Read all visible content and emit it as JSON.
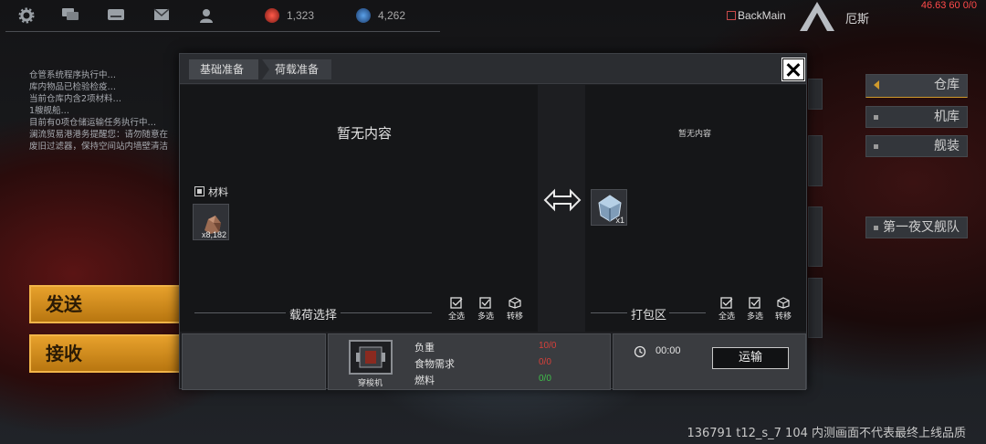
{
  "topbar": {
    "icons": [
      "gear-icon",
      "chat-icon",
      "keyboard-icon",
      "mail-icon",
      "friends-icon"
    ],
    "resource1": {
      "icon": "red-orb-icon",
      "value": "1,323",
      "color": "#c0392b"
    },
    "resource2": {
      "icon": "blue-orb-icon",
      "value": "4,262",
      "color": "#2a6bb0"
    },
    "backmain": "BackMain",
    "player_name": "厄斯",
    "fps": "46.63 60 0/0"
  },
  "log": [
    "仓管系统程序执行中…",
    "库内物品已检验检疫…",
    "当前仓库内含2项材料…",
    "1艘舰船…",
    "目前有0项仓储运输任务执行中…",
    "澜流贸易港港务提醒您：请勿随意在",
    "废旧过滤器，保持空间站内墙壁清洁"
  ],
  "left_buttons": {
    "send": "发送",
    "receive": "接收"
  },
  "right_menu": {
    "warehouse": "仓库",
    "hangar": "机库",
    "outfit": "舰装",
    "fleet": "第一夜叉舰队"
  },
  "modal": {
    "tabs": [
      "基础准备",
      "荷载准备"
    ],
    "left_empty": "暂无内容",
    "right_empty": "暂无内容",
    "category": "材料",
    "left_item": {
      "icon": "ore-icon",
      "qty": "x8,182"
    },
    "right_item": {
      "icon": "cargo-crate-icon",
      "qty": "x1"
    },
    "left_section": "载荷选择",
    "right_section": "打包区",
    "controls": [
      "全选",
      "多选",
      "转移"
    ],
    "ship_label": "穿梭机",
    "stats": [
      {
        "label": "负重",
        "value": "10/0",
        "color": "#d8403a"
      },
      {
        "label": "食物需求",
        "value": "0/0",
        "color": "#d8403a"
      },
      {
        "label": "燃料",
        "value": "0/0",
        "color": "#3fbf4a"
      }
    ],
    "timer": "00:00",
    "ship_button": "运输"
  },
  "footer": "136791 t12_s_7 104  内测画面不代表最终上线品质"
}
